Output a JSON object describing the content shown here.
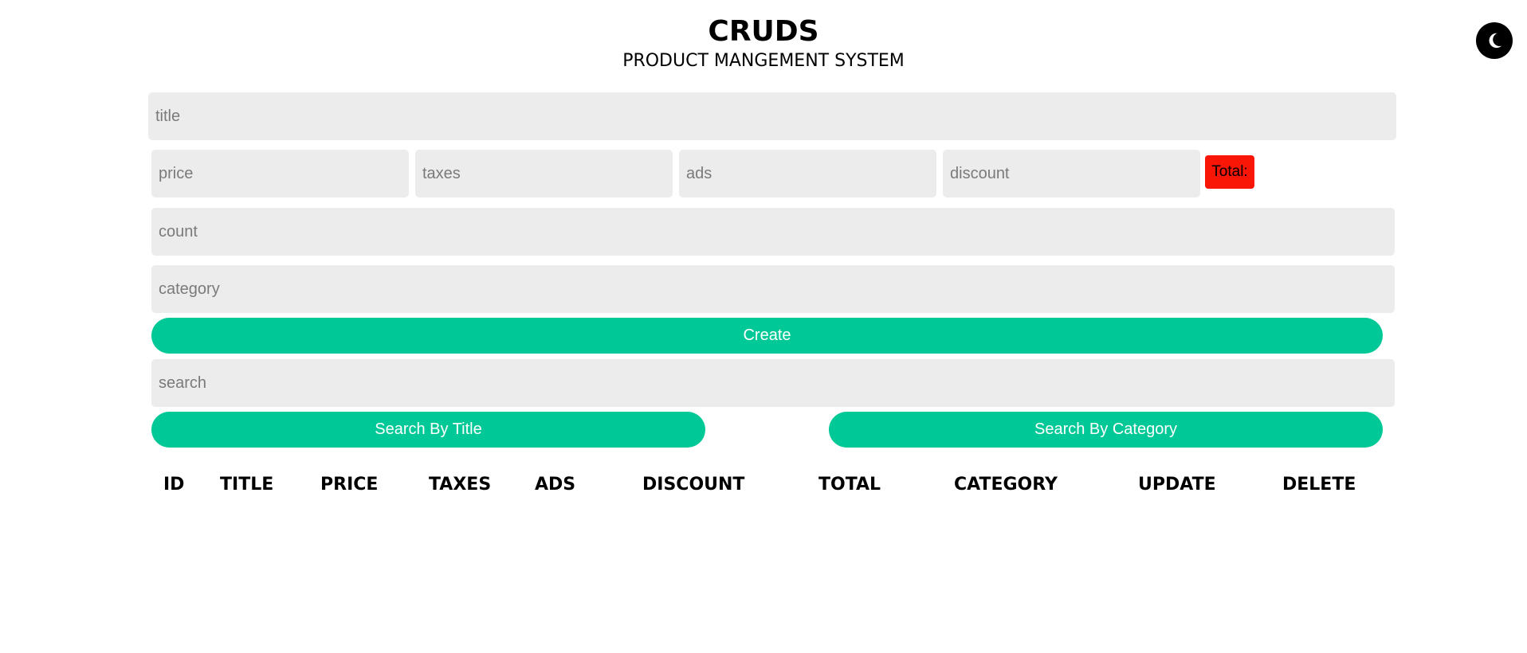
{
  "header": {
    "title": "CRUDS",
    "subtitle": "PRODUCT MANGEMENT SYSTEM"
  },
  "theme_toggle": {
    "icon": "moon-icon"
  },
  "form": {
    "title_placeholder": "title",
    "price_placeholder": "price",
    "taxes_placeholder": "taxes",
    "ads_placeholder": "ads",
    "discount_placeholder": "discount",
    "total_label": "Total:",
    "count_placeholder": "count",
    "category_placeholder": "category",
    "create_label": "Create"
  },
  "search": {
    "placeholder": "search",
    "by_title_label": "Search By Title",
    "by_category_label": "Search By Category"
  },
  "table": {
    "columns": [
      "ID",
      "TITLE",
      "PRICE",
      "TAXES",
      "ADS",
      "DISCOUNT",
      "TOTAL",
      "CATEGORY",
      "UPDATE",
      "DELETE"
    ]
  },
  "colors": {
    "accent": "#00c896",
    "total_badge": "#fa1606",
    "input_bg": "#ececec"
  }
}
